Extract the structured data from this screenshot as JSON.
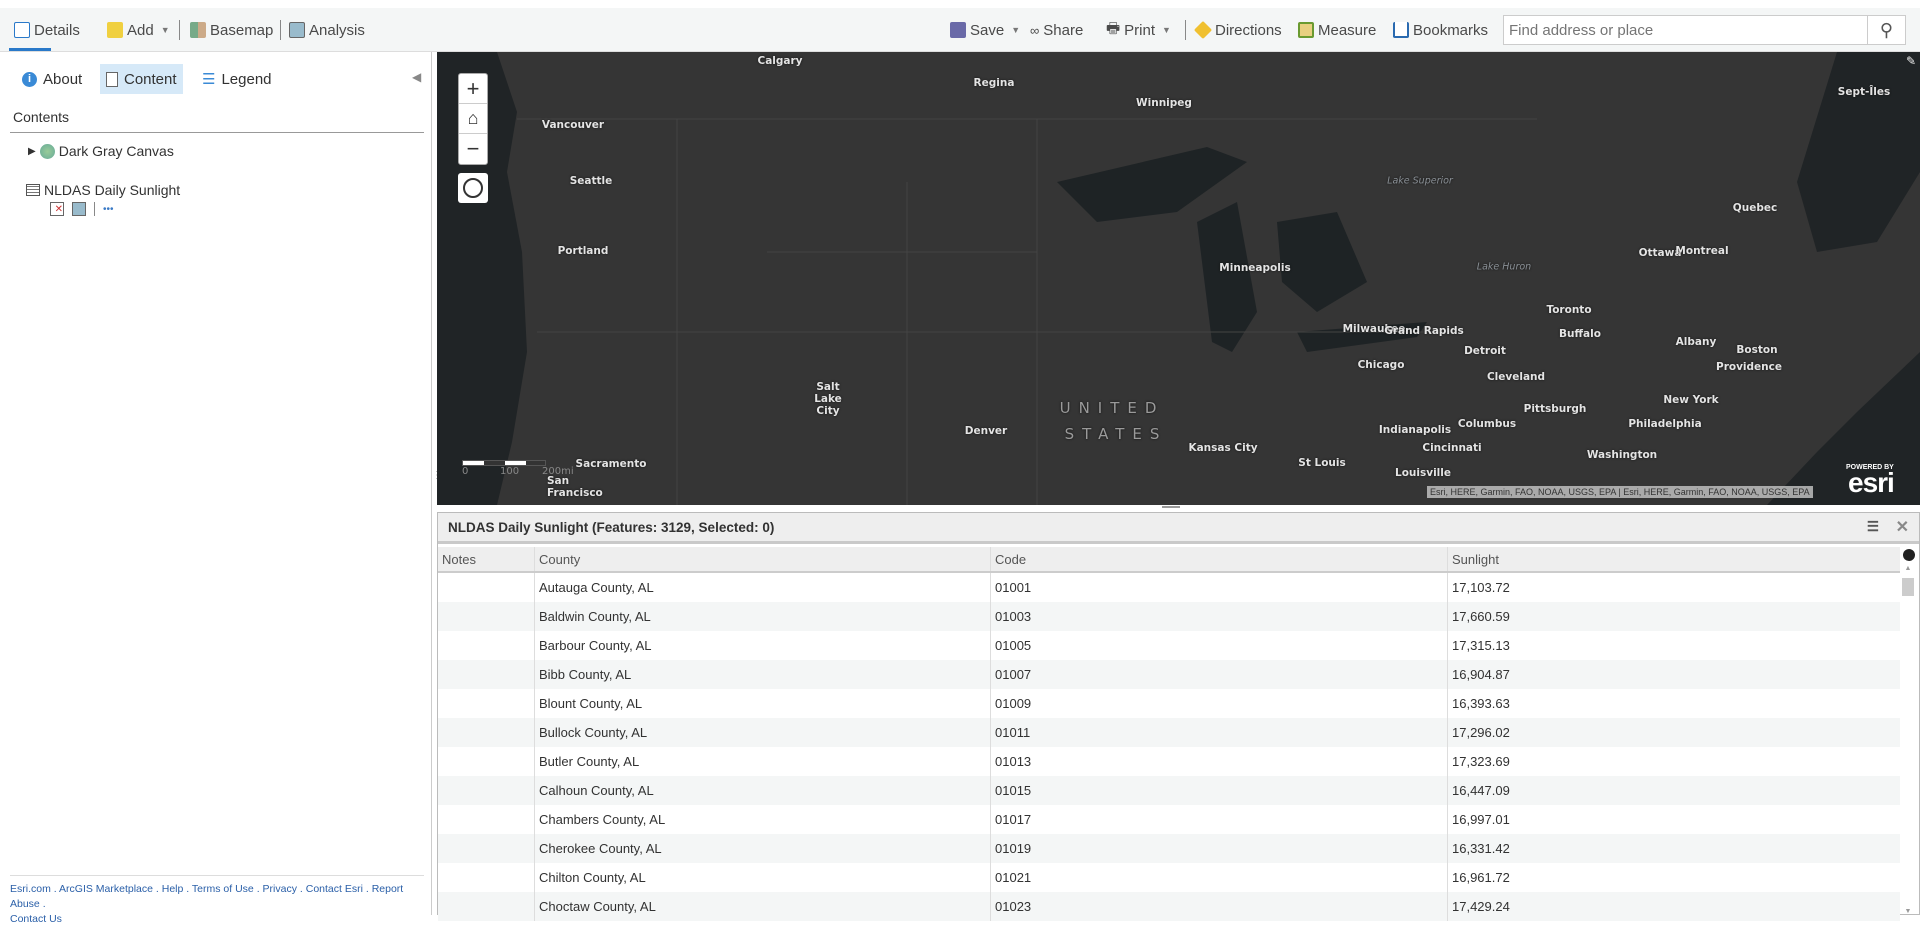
{
  "toolbar": {
    "details": "Details",
    "add": "Add",
    "basemap": "Basemap",
    "analysis": "Analysis",
    "save": "Save",
    "share": "Share",
    "print": "Print",
    "directions": "Directions",
    "measure": "Measure",
    "bookmarks": "Bookmarks",
    "search_placeholder": "Find address or place"
  },
  "sidebar": {
    "tabs": {
      "about": "About",
      "content": "Content",
      "legend": "Legend"
    },
    "contents_heading": "Contents",
    "layers": [
      "Dark Gray Canvas",
      "NLDAS Daily Sunlight"
    ],
    "more": "•••"
  },
  "footer": {
    "links": [
      "Esri.com",
      "ArcGIS Marketplace",
      "Help",
      "Terms of Use",
      "Privacy",
      "Contact Esri",
      "Report Abuse",
      "Contact Us"
    ]
  },
  "map": {
    "labels": [
      "Calgary",
      "Regina",
      "Winnipeg",
      "Sept-Îles",
      "Vancouver",
      "Seattle",
      "Portland",
      "Minneapolis",
      "Quebec",
      "Ottawa",
      "Montreal",
      "Toronto",
      "Buffalo",
      "Milwaukee",
      "Grand Rapids",
      "Albany",
      "Boston",
      "Providence",
      "Detroit",
      "Cleveland",
      "Chicago",
      "Salt Lake City",
      "Pittsburgh",
      "New York",
      "Philadelphia",
      "Denver",
      "Indianapolis",
      "Columbus",
      "Cincinnati",
      "Kansas City",
      "St Louis",
      "Washington",
      "Louisville",
      "Sacramento",
      "San Francisco"
    ],
    "lakes": [
      "Lake Superior",
      "Lake Huron"
    ],
    "country": [
      "UNITED",
      "STATES"
    ],
    "scale": [
      "0",
      "100",
      "200mi"
    ],
    "attribution": "Esri, HERE, Garmin, FAO, NOAA, USGS, EPA | Esri, HERE, Garmin, FAO, NOAA, USGS, EPA",
    "powered_by": "POWERED BY",
    "esri_logo": "esri"
  },
  "table": {
    "title": "NLDAS Daily Sunlight (Features: 3129, Selected: 0)",
    "columns": [
      "Notes",
      "County",
      "Code",
      "Sunlight"
    ],
    "rows": [
      [
        "",
        "Autauga County, AL",
        "01001",
        "17,103.72"
      ],
      [
        "",
        "Baldwin County, AL",
        "01003",
        "17,660.59"
      ],
      [
        "",
        "Barbour County, AL",
        "01005",
        "17,315.13"
      ],
      [
        "",
        "Bibb County, AL",
        "01007",
        "16,904.87"
      ],
      [
        "",
        "Blount County, AL",
        "01009",
        "16,393.63"
      ],
      [
        "",
        "Bullock County, AL",
        "01011",
        "17,296.02"
      ],
      [
        "",
        "Butler County, AL",
        "01013",
        "17,323.69"
      ],
      [
        "",
        "Calhoun County, AL",
        "01015",
        "16,447.09"
      ],
      [
        "",
        "Chambers County, AL",
        "01017",
        "16,997.01"
      ],
      [
        "",
        "Cherokee County, AL",
        "01019",
        "16,331.42"
      ],
      [
        "",
        "Chilton County, AL",
        "01021",
        "16,961.72"
      ],
      [
        "",
        "Choctaw County, AL",
        "01023",
        "17,429.24"
      ]
    ]
  }
}
